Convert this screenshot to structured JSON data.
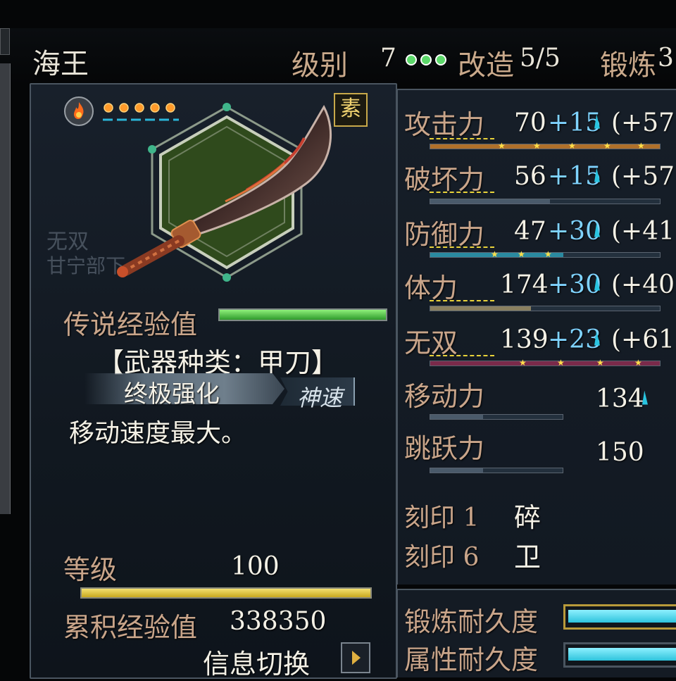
{
  "title_bar": {
    "weapon_name": "海王",
    "level_label": "级别",
    "level_value": "7",
    "modify_label": "改造",
    "modify_value": "5/5",
    "forge_label": "锻炼",
    "forge_value_partial": "3"
  },
  "weapon": {
    "rarity_badge": "素",
    "legend_exp_label": "传说经验值",
    "weapon_type": "【武器种类：甲刀】",
    "ultimate_label": "终极强化",
    "ultimate_skill": "神速",
    "description": "移动速度最大。",
    "watermark_1": "无双",
    "watermark_2": "甘宁部下"
  },
  "level": {
    "label": "等级",
    "value": "100",
    "cumulative_exp_label": "累积经验值",
    "cumulative_exp_value": "338350",
    "info_switch_label": "信息切换"
  },
  "stats": [
    {
      "label": "攻击力",
      "base": "70",
      "bonus": "+15",
      "extra": "(+57"
    },
    {
      "label": "破坏力",
      "base": "56",
      "bonus": "+15",
      "extra": "(+57"
    },
    {
      "label": "防御力",
      "base": "47",
      "bonus": "+30",
      "extra": "(+41"
    },
    {
      "label": "体力",
      "base": "174",
      "bonus": "+30",
      "extra": "(+40"
    },
    {
      "label": "无双",
      "base": "139",
      "bonus": "+23",
      "extra": "(+61"
    },
    {
      "label": "移动力",
      "base": "134"
    },
    {
      "label": "跳跃力",
      "base": "150"
    }
  ],
  "seals": [
    {
      "label": "刻印 1",
      "value": "碎"
    },
    {
      "label": "刻印 6",
      "value": "卫"
    }
  ],
  "durability": {
    "forge_label": "锻炼耐久度",
    "attribute_label": "属性耐久度",
    "forge_fill": 1.0,
    "attribute_fill": 1.0
  },
  "element_orbs": 5,
  "colors": {
    "accent_gold": "#e8d23a",
    "bonus_blue": "#7fd3ff",
    "label_tan": "#c9a58a",
    "exp_green": "#4ec24a",
    "cyan_bar": "#2ec3dc"
  },
  "icons": [
    "fire-orb-icon",
    "weapon-sword-icon",
    "hexagon-frame-icon",
    "arrow-right-icon"
  ]
}
